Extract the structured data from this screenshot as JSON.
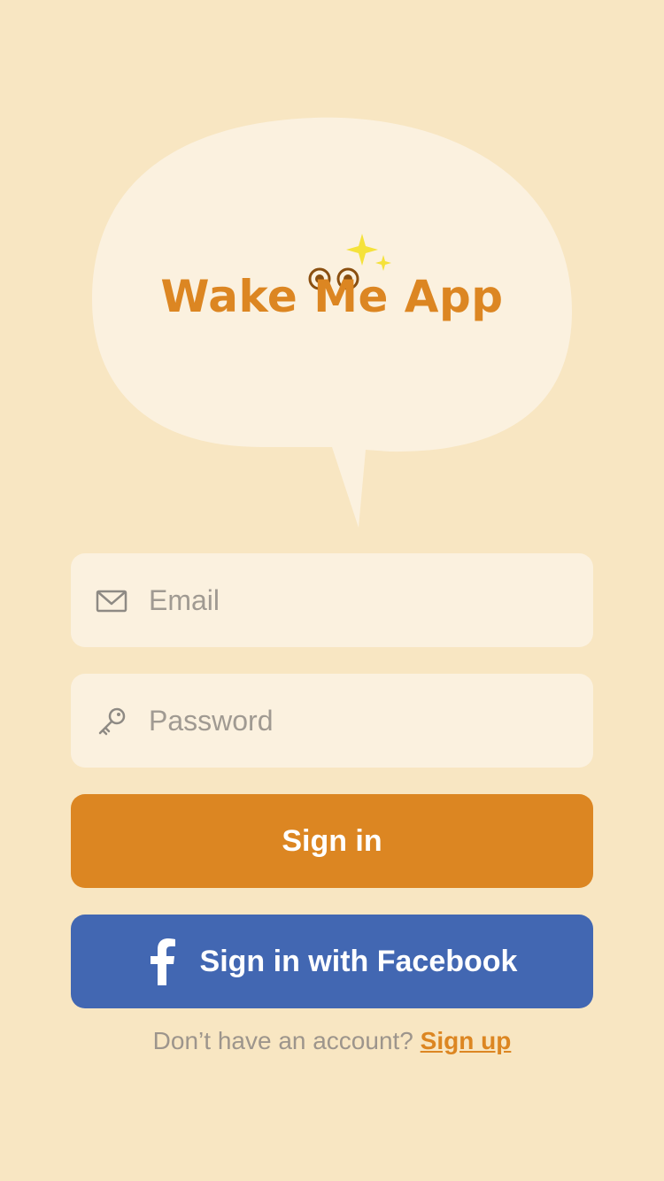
{
  "app": {
    "title": "Wake Me App"
  },
  "form": {
    "email": {
      "placeholder": "Email",
      "value": ""
    },
    "password": {
      "placeholder": "Password",
      "value": ""
    }
  },
  "actions": {
    "sign_in_label": "Sign in",
    "facebook_label": "Sign in with Facebook"
  },
  "footer": {
    "prompt": "Don’t have an account?",
    "sign_up_label": "Sign up"
  },
  "icons": {
    "email": "envelope-icon",
    "password": "key-icon",
    "facebook": "facebook-icon"
  },
  "colors": {
    "background": "#f8e6c2",
    "bubble": "#fbf1df",
    "accent": "#dc8622",
    "facebook": "#4267b2",
    "sparkle": "#f5e23a",
    "muted_text": "#9d958c"
  }
}
